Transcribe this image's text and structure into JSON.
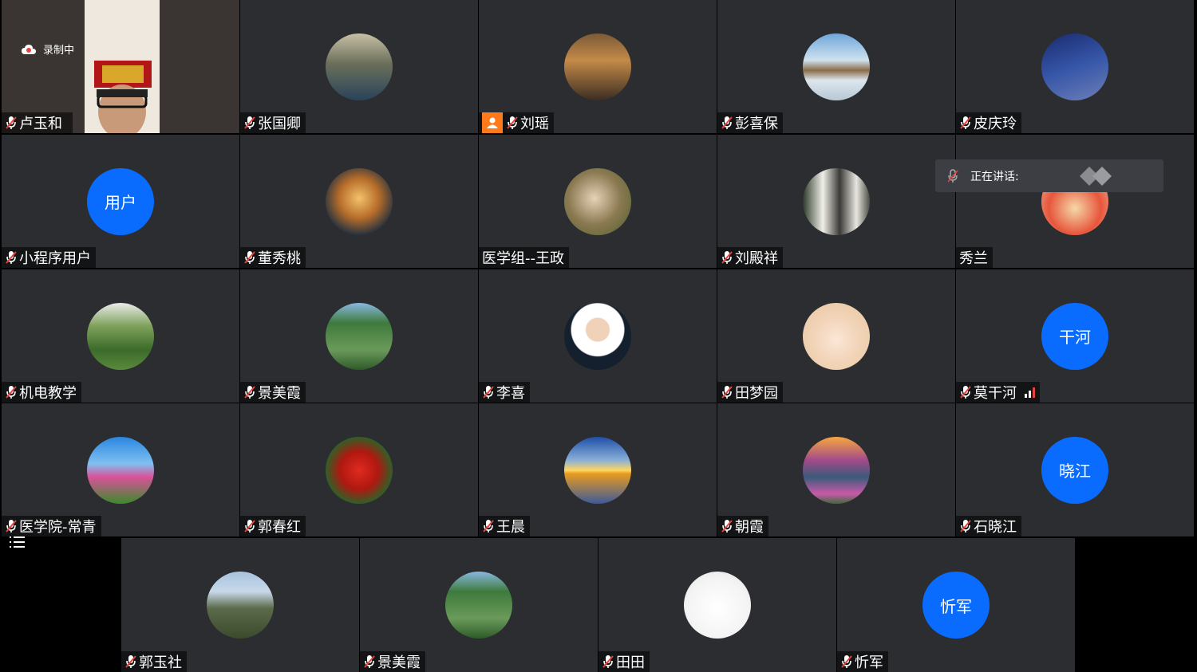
{
  "recording": {
    "label": "录制中"
  },
  "speaking": {
    "label": "正在讲话:"
  },
  "participants": [
    {
      "name": "卢玉和",
      "avatar": "camera-video",
      "muted": true
    },
    {
      "name": "张国卿",
      "avatar": "landscape-sunset-photo",
      "muted": true
    },
    {
      "name": "刘瑶",
      "avatar": "street-night-photo",
      "muted": true,
      "badge": "user-icon"
    },
    {
      "name": "彭喜保",
      "avatar": "frozen-lake-photo",
      "muted": true
    },
    {
      "name": "皮庆玲",
      "avatar": "city-sky-photo",
      "muted": true
    },
    {
      "name": "小程序用户",
      "avatar_text": "用户",
      "muted": true
    },
    {
      "name": "董秀桃",
      "avatar": "mushroom-photo",
      "muted": true
    },
    {
      "name": "医学组--王政",
      "avatar": "baby-photo",
      "muted": false
    },
    {
      "name": "刘殿祥",
      "avatar": "bookshelf-photo",
      "muted": true
    },
    {
      "name": "秀兰",
      "avatar": "cake-photo",
      "muted": false
    },
    {
      "name": "机电教学",
      "avatar": "garden-trees-photo",
      "muted": true
    },
    {
      "name": "景美霞",
      "avatar": "yoga-mountain-photo",
      "muted": true
    },
    {
      "name": "李喜",
      "avatar": "man-portrait-photo",
      "muted": true
    },
    {
      "name": "田梦园",
      "avatar": "anime-girl-photo",
      "muted": true
    },
    {
      "name": "莫干河",
      "avatar_text": "干河",
      "muted": true,
      "signal": true
    },
    {
      "name": "医学院-常青",
      "avatar": "flower-field-photo",
      "muted": true
    },
    {
      "name": "郭春红",
      "avatar": "red-flowers-photo",
      "muted": true
    },
    {
      "name": "王晨",
      "avatar": "sunset-lake-photo",
      "muted": true
    },
    {
      "name": "朝霞",
      "avatar": "mountain-flowers-photo",
      "muted": true
    },
    {
      "name": "石晓江",
      "avatar_text": "晓江",
      "muted": true
    },
    {
      "name": "郭玉社",
      "avatar": "temple-mountain-photo",
      "muted": true
    },
    {
      "name": "景美霞",
      "avatar": "yoga-mountain-photo",
      "muted": true
    },
    {
      "name": "田田",
      "avatar": "cartoon-boy-photo",
      "muted": true
    },
    {
      "name": "忻军",
      "avatar_text": "忻军",
      "muted": true
    }
  ],
  "colors": {
    "tile_bg": "#2b2d31",
    "avatar_blue": "#0a6cff",
    "mic_red": "#e5433d",
    "badge_orange": "#ff7a1a"
  }
}
